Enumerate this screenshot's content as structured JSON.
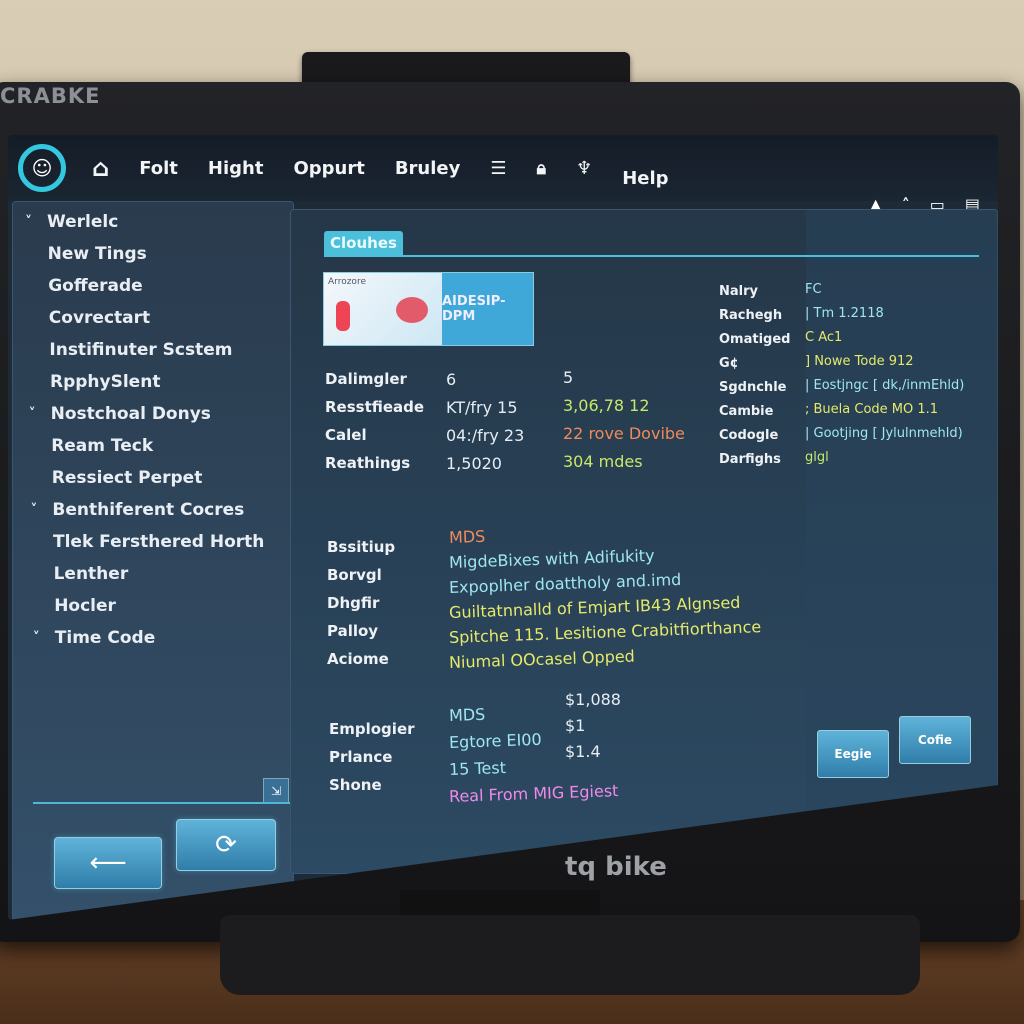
{
  "bezel": {
    "brand_top": "CRABKE",
    "brand_bottom": "tq bike"
  },
  "topbar": {
    "menu": [
      "Folt",
      "Hight",
      "Oppurt",
      "Bruley",
      "Help"
    ],
    "icons": [
      "logo-icon",
      "home-icon",
      "list-icon",
      "lock-icon",
      "antenna-icon"
    ],
    "right_icons": [
      "bell-icon",
      "chevron-up-icon",
      "window-icon",
      "menu-icon"
    ]
  },
  "sidebar": {
    "items": [
      {
        "label": "Werlelc",
        "chevron": true
      },
      {
        "label": "New Tings"
      },
      {
        "label": "Gofferade"
      },
      {
        "label": "Covrectart"
      },
      {
        "label": "Instifinuter Scstem"
      },
      {
        "label": "RpphySlent"
      },
      {
        "label": "Nostchoal Donys",
        "chevron": true
      },
      {
        "label": "Ream Teck"
      },
      {
        "label": "Ressiect Perpet"
      },
      {
        "label": "Benthiferent Cocres",
        "chevron": true
      },
      {
        "label": "Tlek Fersthered Horth"
      },
      {
        "label": "Lenther"
      },
      {
        "label": "Hocler"
      },
      {
        "label": "Time Code",
        "chevron": true
      }
    ],
    "back_icon": "arrow-left-icon",
    "refresh_icon": "refresh-icon"
  },
  "main": {
    "tab": "Clouhes",
    "banner": {
      "caption": "Arrozore",
      "title": "AIDESIP-DPM"
    },
    "rows": [
      [
        "Dalimgler",
        "6",
        "5"
      ],
      [
        "Resstfieade",
        "KT/fry 15",
        "3,06,78 12"
      ],
      [
        "Calel",
        "04:/fry 23",
        "22 rove Dovibe"
      ],
      [
        "Reathings",
        "1,5020",
        "304 mdes"
      ]
    ],
    "details": {
      "labels": [
        "Bssitiup",
        "Borvgl",
        "Dhgfir",
        "Palloy",
        "Aciome"
      ],
      "lines": [
        "MDS",
        "MigdeBixes with Adifukity",
        "Expoplher doattholy and.imd",
        "Guiltatnnalld of Emjart IB43 Algnsed",
        "Spitche 115. Lesitione Crabitfiorthance",
        "Niumal OOcasel Opped"
      ]
    },
    "costs": {
      "labels": [
        "Emplogier",
        "Prlance",
        "Shone"
      ],
      "items": [
        "MDS",
        "Egtore EI00",
        "15 Test",
        "Real From MIG Egiest"
      ],
      "prices": [
        "$1,088",
        "$1",
        "$1.4"
      ]
    },
    "right": {
      "rows": [
        [
          "Nalry",
          "FC"
        ],
        [
          "Rachegh",
          "| Tm 1.2118"
        ],
        [
          "Omatiged",
          "C Ac1"
        ],
        [
          "G¢",
          "] Nowe Tode 912"
        ],
        [
          "Sgdnchle",
          "| Eostjngc [ dk,/inmEhld)"
        ],
        [
          "Cambie",
          "; Buela Code MO 1.1"
        ],
        [
          "Codogle",
          "| Gootjing [ Jylulnmehld)"
        ],
        [
          "Darfighs",
          "glgl"
        ]
      ],
      "buttons": [
        "Eegie",
        "Cofie"
      ]
    }
  }
}
